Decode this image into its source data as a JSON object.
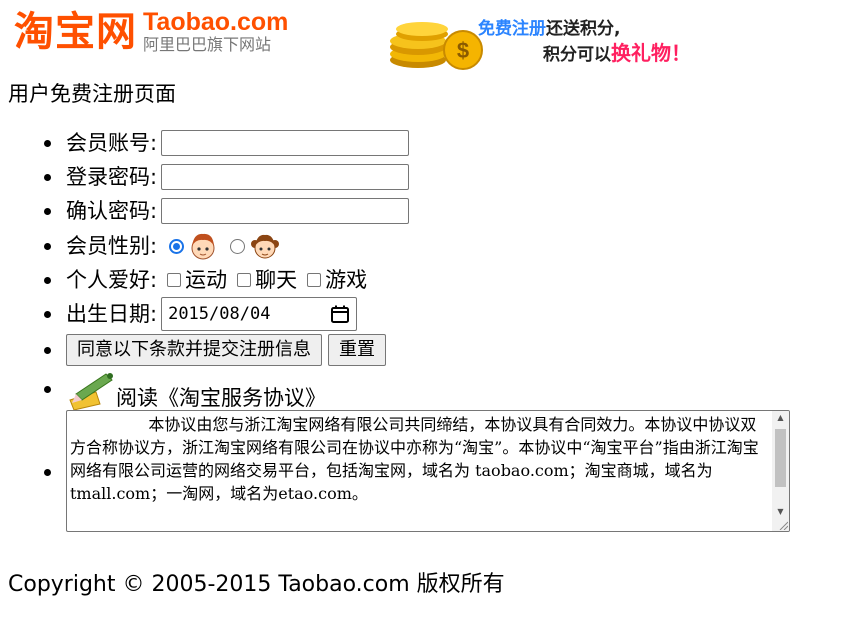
{
  "header": {
    "logo_cn": "淘宝网",
    "logo_en": "Taobao.com",
    "logo_sub": "阿里巴巴旗下网站",
    "banner": {
      "line1_blue": "免费注册",
      "line1_dark": "还送积分,",
      "line2_dark": "积分可以",
      "line2_red": "换礼物！"
    }
  },
  "page_title": "用户免费注册页面",
  "form": {
    "account_label": "会员账号:",
    "account_value": "",
    "password_label": "登录密码:",
    "password_value": "",
    "confirm_label": "确认密码:",
    "confirm_value": "",
    "gender_label": "会员性别:",
    "gender_selected": "male",
    "hobby_label": "个人爱好:",
    "hobbies": [
      "运动",
      "聊天",
      "游戏"
    ],
    "birthday_label": "出生日期:",
    "birthday_value": "2015/08/04",
    "submit_label": "同意以下条款并提交注册信息",
    "reset_label": "重置",
    "agreement_link": "阅读《淘宝服务协议》",
    "agreement_text": "本协议由您与浙江淘宝网络有限公司共同缔结，本协议具有合同效力。本协议中协议双方合称协议方，浙江淘宝网络有限公司在协议中亦称为“淘宝”。本协议中“淘宝平台”指由浙江淘宝网络有限公司运营的网络交易平台，包括淘宝网，域名为 taobao.com；淘宝商城，域名为tmall.com；一淘网，域名为etao.com。"
  },
  "footer": "Copyright © 2005-2015 Taobao.com 版权所有",
  "colors": {
    "brand_orange": "#ff5000",
    "banner_blue": "#2b84ff",
    "banner_red": "#ff2060",
    "radio_blue": "#1a73e8"
  },
  "icons": [
    "coins-icon",
    "male-avatar-icon",
    "female-avatar-icon",
    "calendar-icon",
    "pencil-icon"
  ]
}
